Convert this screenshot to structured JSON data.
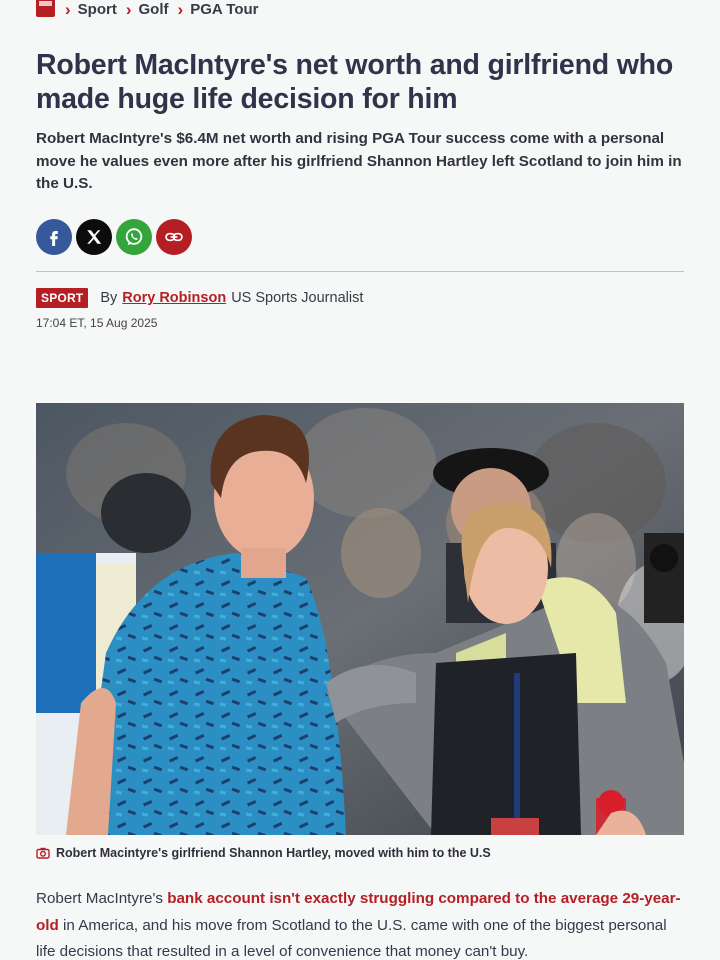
{
  "breadcrumb": {
    "items": [
      "Sport",
      "Golf",
      "PGA Tour"
    ]
  },
  "article": {
    "title": "Robert MacIntyre's net worth and girlfriend who made huge life decision for him",
    "standfirst": "Robert MacIntyre's $6.4M net worth and rising PGA Tour success come with a personal move he values even more after his girlfriend Shannon Hartley left Scotland to join him in the U.S.",
    "section_badge": "SPORT",
    "by_label": "By",
    "author": "Rory Robinson",
    "author_role": "US Sports Journalist",
    "timestamp": "17:04 ET, 15 Aug 2025",
    "caption": "Robert Macintyre's girlfriend Shannon Hartley, moved with him to the U.S",
    "body_prefix": "Robert MacIntyre's ",
    "body_link": "bank account isn't exactly struggling compared to the average 29-year-old",
    "body_suffix": " in America, and his move from Scotland to the U.S. came with one of the biggest personal life decisions that resulted in a level of convenience that money can't buy."
  },
  "share_buttons": [
    {
      "icon": "facebook-icon",
      "color": "#35599a"
    },
    {
      "icon": "x-icon",
      "color": "#0c0c0c"
    },
    {
      "icon": "whatsapp-icon",
      "color": "#33a53b"
    },
    {
      "icon": "link-icon",
      "color": "#b51f24"
    }
  ],
  "theme": {
    "accent": "#b51f24",
    "text": "#32324a",
    "background": "#f6f7f7"
  }
}
